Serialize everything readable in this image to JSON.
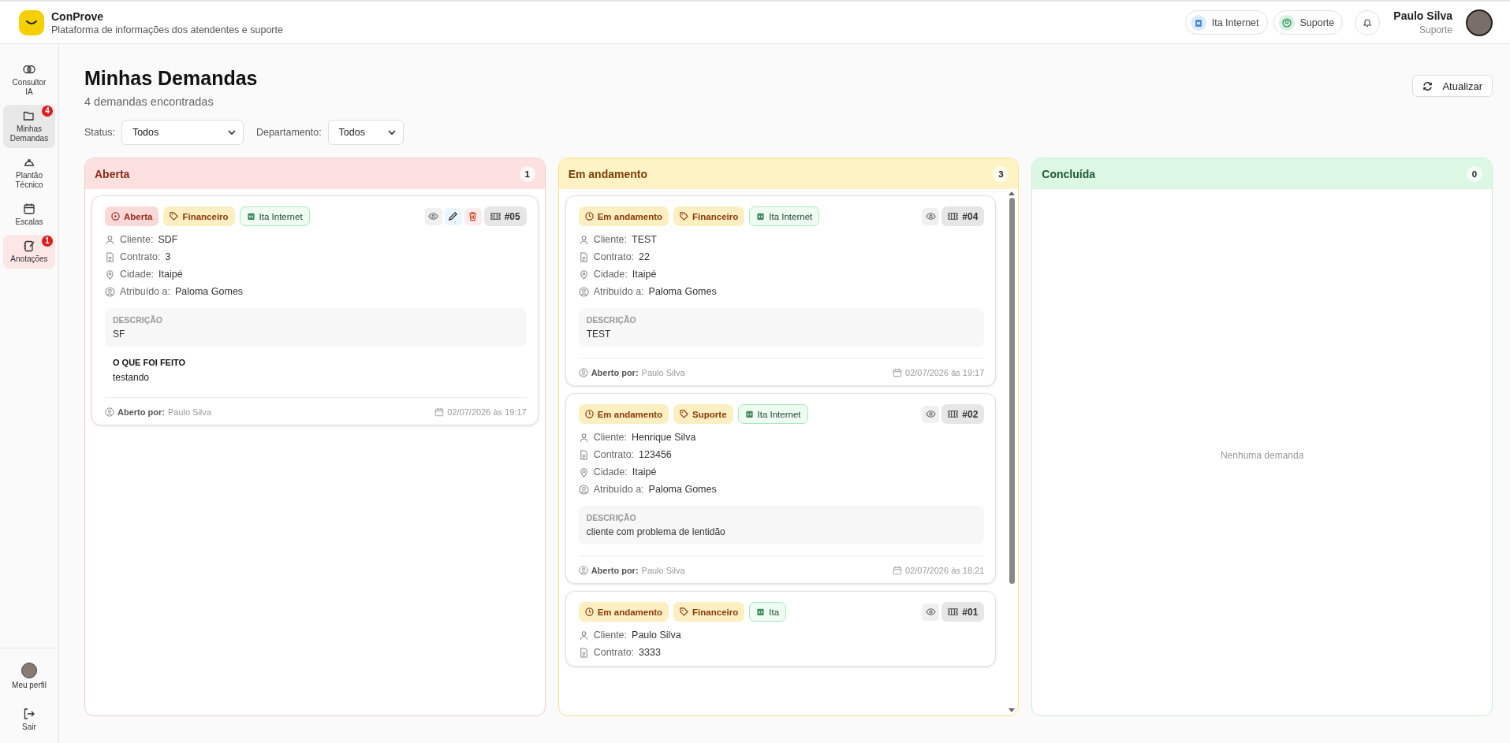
{
  "app": {
    "name": "ConProve",
    "subtitle": "Plataforma de informações dos atendentes e suporte"
  },
  "header": {
    "chips": [
      {
        "label": "Ita Internet",
        "kind": "company"
      },
      {
        "label": "Suporte",
        "kind": "role"
      }
    ],
    "user": {
      "name": "Paulo Silva",
      "role": "Suporte"
    }
  },
  "sidebar": {
    "items": [
      {
        "label": "Consultor IA",
        "selected": false,
        "highlighted": false
      },
      {
        "label": "Minhas Demandas",
        "selected": true,
        "highlighted": false,
        "badge": "4"
      },
      {
        "label": "Plantão Técnico",
        "selected": false,
        "highlighted": false
      },
      {
        "label": "Escalas",
        "selected": false,
        "highlighted": false
      },
      {
        "label": "Anotações",
        "selected": false,
        "highlighted": true,
        "badge": "1"
      }
    ],
    "bottom": [
      {
        "label": "Meu perfil"
      },
      {
        "label": "Sair"
      }
    ]
  },
  "page": {
    "title": "Minhas Demandas",
    "subtitle": "4 demandas encontradas",
    "refresh": "Atualizar",
    "filters": [
      {
        "label": "Status:",
        "value": "Todos"
      },
      {
        "label": "Departamento:",
        "value": "Todos"
      }
    ]
  },
  "columns": [
    {
      "title": "Aberta",
      "kind": "open",
      "count": "1",
      "cards": [
        {
          "status": {
            "label": "Aberta",
            "kind": "open"
          },
          "department": "Financeiro",
          "company": "Ita Internet",
          "actions": [
            {
              "kind": "view"
            },
            {
              "kind": "edit"
            },
            {
              "kind": "delete"
            }
          ],
          "ticket": "#05",
          "fields": [
            {
              "kind": "client",
              "label": "Cliente:",
              "value": "SDF"
            },
            {
              "kind": "contract",
              "label": "Contrato:",
              "value": "3"
            },
            {
              "kind": "city",
              "label": "Cidade:",
              "value": "Itaipé"
            },
            {
              "kind": "assignee",
              "label": "Atribuído a:",
              "value": "Paloma Gomes"
            }
          ],
          "description": {
            "label": "DESCRIÇÃO",
            "text": "SF"
          },
          "done": {
            "label": "O QUE FOI FEITO",
            "text": "testando"
          },
          "footer": {
            "opened_label": "Aberto por:",
            "opened_by": "Paulo Silva",
            "date": "02/07/2026 às 19:17"
          }
        }
      ]
    },
    {
      "title": "Em andamento",
      "kind": "progress",
      "count": "3",
      "cards": [
        {
          "status": {
            "label": "Em andamento",
            "kind": "progress"
          },
          "department": "Financeiro",
          "company": "Ita Internet",
          "actions": [
            {
              "kind": "view"
            }
          ],
          "ticket": "#04",
          "fields": [
            {
              "kind": "client",
              "label": "Cliente:",
              "value": "TEST"
            },
            {
              "kind": "contract",
              "label": "Contrato:",
              "value": "22"
            },
            {
              "kind": "city",
              "label": "Cidade:",
              "value": "Itaipé"
            },
            {
              "kind": "assignee",
              "label": "Atribuído a:",
              "value": "Paloma Gomes"
            }
          ],
          "description": {
            "label": "DESCRIÇÃO",
            "text": "TEST"
          },
          "footer": {
            "opened_label": "Aberto por:",
            "opened_by": "Paulo Silva",
            "date": "02/07/2026 às 19:17"
          }
        },
        {
          "status": {
            "label": "Em andamento",
            "kind": "progress"
          },
          "department": "Suporte",
          "company": "Ita Internet",
          "actions": [
            {
              "kind": "view"
            }
          ],
          "ticket": "#02",
          "fields": [
            {
              "kind": "client",
              "label": "Cliente:",
              "value": "Henrique Silva"
            },
            {
              "kind": "contract",
              "label": "Contrato:",
              "value": "123456"
            },
            {
              "kind": "city",
              "label": "Cidade:",
              "value": "Itaipé"
            },
            {
              "kind": "assignee",
              "label": "Atribuído a:",
              "value": "Paloma Gomes"
            }
          ],
          "description": {
            "label": "DESCRIÇÃO",
            "text": "cliente com problema de lentidão"
          },
          "footer": {
            "opened_label": "Aberto por:",
            "opened_by": "Paulo Silva",
            "date": "02/07/2026 às 18:21"
          }
        },
        {
          "status": {
            "label": "Em andamento",
            "kind": "progress"
          },
          "department": "Financeiro",
          "company": "Ita",
          "actions": [
            {
              "kind": "view"
            }
          ],
          "ticket": "#01",
          "fields": [
            {
              "kind": "client",
              "label": "Cliente:",
              "value": "Paulo Silva"
            },
            {
              "kind": "contract",
              "label": "Contrato:",
              "value": "3333"
            }
          ]
        }
      ]
    },
    {
      "title": "Concluída",
      "kind": "done",
      "count": "0",
      "empty_text": "Nenhuma demanda"
    }
  ]
}
